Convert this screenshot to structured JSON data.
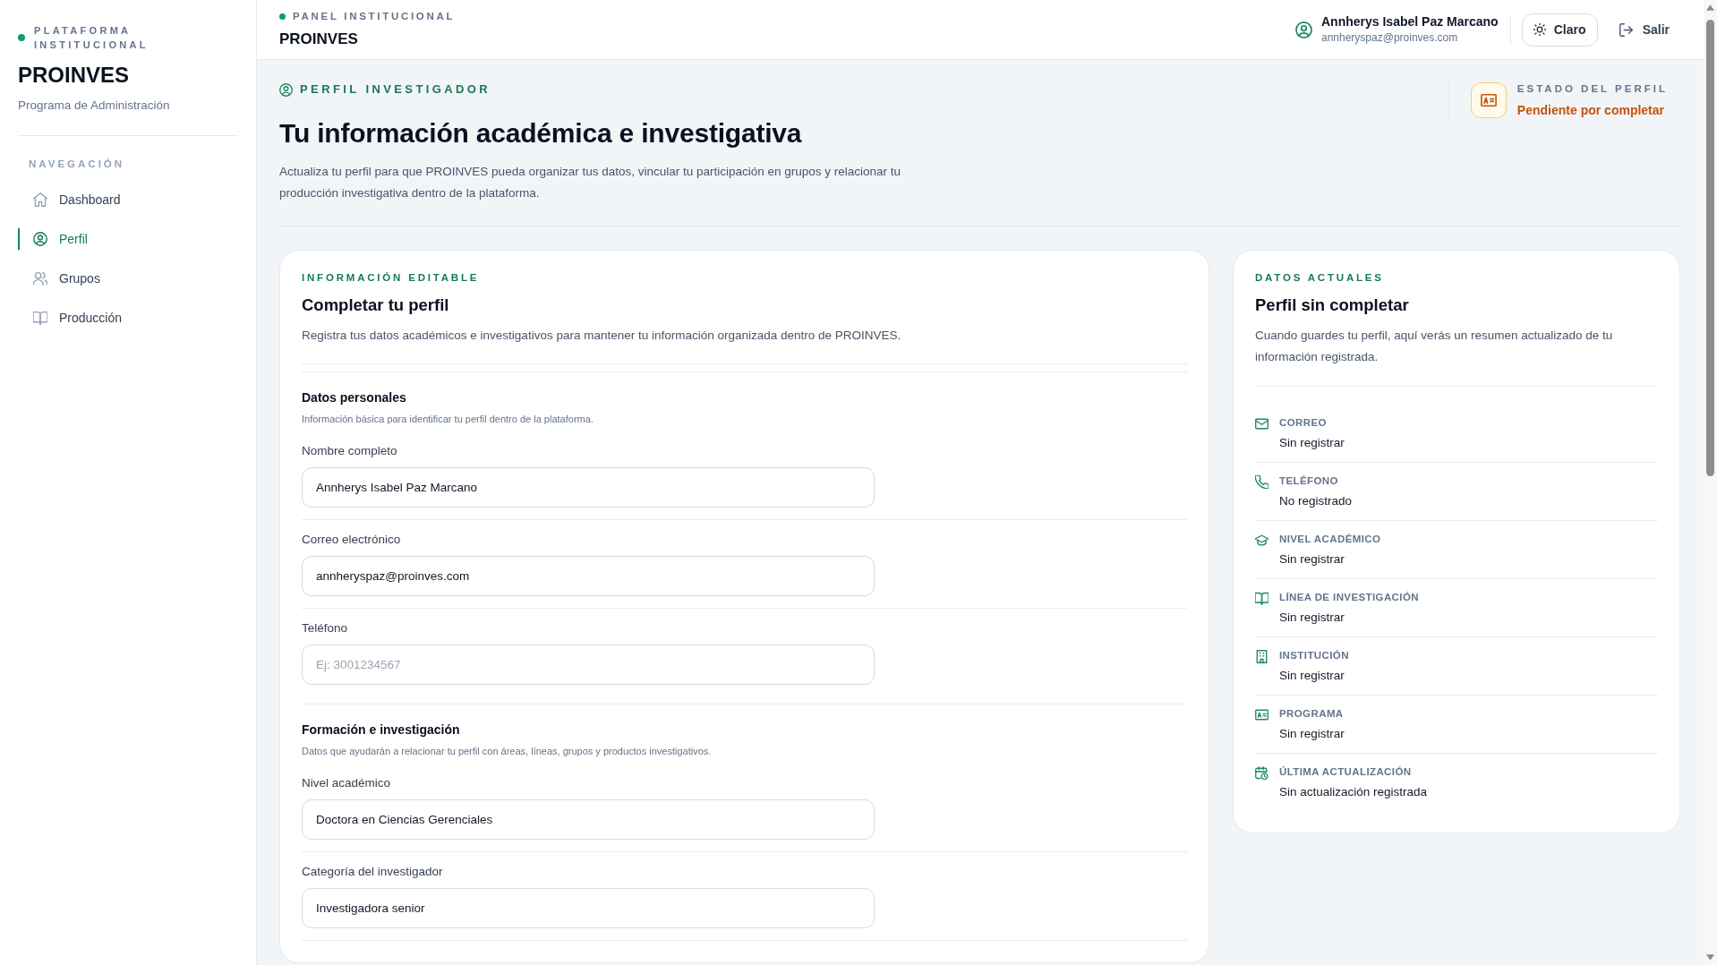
{
  "sidebar": {
    "platform_label": "PLATAFORMA INSTITUCIONAL",
    "brand": "PROINVES",
    "subtitle": "Programa de Administración",
    "nav_heading": "NAVEGACIÓN",
    "items": [
      {
        "label": "Dashboard",
        "selected": false
      },
      {
        "label": "Perfil",
        "selected": true
      },
      {
        "label": "Grupos",
        "selected": false
      },
      {
        "label": "Producción",
        "selected": false
      }
    ]
  },
  "top_bar": {
    "panel_label": "PANEL INSTITUCIONAL",
    "title": "PROINVES",
    "user": {
      "name": "Annherys Isabel Paz Marcano",
      "email": "annheryspaz@proinves.com"
    },
    "theme_button": "Claro",
    "logout_button": "Salir"
  },
  "page_header": {
    "eyebrow": "PERFIL INVESTIGADOR",
    "title": "Tu información académica e investigativa",
    "description": "Actualiza tu perfil para que PROINVES pueda organizar tus datos, vincular tu participación en grupos y relacionar tu producción investigativa dentro de la plataforma.",
    "profile_status": {
      "label": "ESTADO DEL PERFIL",
      "value": "Pendiente por completar"
    }
  },
  "form_card": {
    "eyebrow": "INFORMACIÓN EDITABLE",
    "title": "Completar tu perfil",
    "description": "Registra tus datos académicos e investigativos para mantener tu información organizada dentro de PROINVES.",
    "sections": [
      {
        "title": "Datos personales",
        "hint": "Información básica para identificar tu perfil dentro de la plataforma.",
        "fields": [
          {
            "label": "Nombre completo",
            "value": "Annherys Isabel Paz Marcano"
          },
          {
            "label": "Correo electrónico",
            "value": "annheryspaz@proinves.com"
          },
          {
            "label": "Teléfono",
            "placeholder": "Ej: 3001234567"
          }
        ]
      },
      {
        "title": "Formación e investigación",
        "hint": "Datos que ayudarán a relacionar tu perfil con áreas, líneas, grupos y productos investigativos.",
        "fields": [
          {
            "label": "Nivel académico",
            "value": "Doctora en Ciencias Gerenciales"
          },
          {
            "label": "Categoría del investigador",
            "value": "Investigadora senior"
          }
        ]
      }
    ]
  },
  "summary_card": {
    "eyebrow": "DATOS ACTUALES",
    "title": "Perfil sin completar",
    "description": "Cuando guardes tu perfil, aquí verás un resumen actualizado de tu información registrada.",
    "items": [
      {
        "label": "CORREO",
        "value": "Sin registrar"
      },
      {
        "label": "TELÉFONO",
        "value": "No registrado"
      },
      {
        "label": "NIVEL ACADÉMICO",
        "value": "Sin registrar"
      },
      {
        "label": "LÍNEA DE INVESTIGACIÓN",
        "value": "Sin registrar"
      },
      {
        "label": "INSTITUCIÓN",
        "value": "Sin registrar"
      },
      {
        "label": "PROGRAMA",
        "value": "Sin registrar"
      },
      {
        "label": "ÚLTIMA ACTUALIZACIÓN",
        "value": "Sin actualización registrada"
      }
    ]
  }
}
